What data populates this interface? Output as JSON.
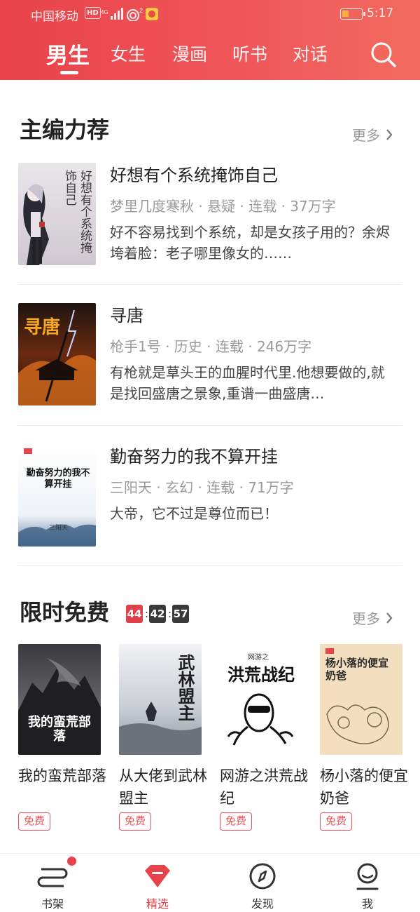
{
  "status_bar": {
    "carrier": "中国移动",
    "hd": "HD",
    "network": "4G",
    "wifi_badge": "2",
    "time": "5:17"
  },
  "header": {
    "tabs": [
      {
        "label": "男生",
        "active": true
      },
      {
        "label": "女生"
      },
      {
        "label": "漫画"
      },
      {
        "label": "听书"
      },
      {
        "label": "对话"
      }
    ],
    "search_icon": "search-icon"
  },
  "editor_picks": {
    "title": "主编力荐",
    "more_label": "更多",
    "books": [
      {
        "title": "好想有个系统掩饰自己",
        "meta": "梦里几度寒秋 · 悬疑 · 连载 · 37万字",
        "desc": "好不容易找到个系统，却是女孩子用的？余烬垮着脸：老子哪里像女的……",
        "cover_text": "好想有个系统掩饰自己"
      },
      {
        "title": "寻唐",
        "meta": "枪手1号 · 历史 · 连载 · 246万字",
        "desc": "有枪就是草头王的血腥时代里.他想要做的,就是找回盛唐之景象,重谱一曲盛唐…",
        "cover_text": "寻唐"
      },
      {
        "title": "勤奋努力的我不算开挂",
        "meta": "三阳天 · 玄幻 · 连载 · 71万字",
        "desc": "大帝，它不过是尊位而已！",
        "cover_text": "勤奋努力的我不算开挂",
        "cover_author": "三阳天"
      }
    ]
  },
  "limited_free": {
    "title": "限时免费",
    "timer": {
      "h": "44",
      "m": "42",
      "s": "57"
    },
    "more_label": "更多",
    "books": [
      {
        "title": "我的蛮荒部落",
        "tag": "免费",
        "cover_text": "我的蛮荒部落"
      },
      {
        "title": "从大佬到武林盟主",
        "tag": "免费",
        "cover_text": "武林盟主"
      },
      {
        "title": "网游之洪荒战纪",
        "tag": "免费",
        "cover_text": "洪荒战纪",
        "cover_top": "网游之"
      },
      {
        "title": "杨小落的便宜奶爸",
        "tag": "免费",
        "cover_text": "杨小落的便宜奶爸"
      }
    ]
  },
  "bottom_nav": [
    {
      "label": "书架",
      "icon": "bookshelf-icon",
      "badge": true
    },
    {
      "label": "精选",
      "icon": "featured-icon",
      "active": true
    },
    {
      "label": "发现",
      "icon": "compass-icon"
    },
    {
      "label": "我",
      "icon": "profile-icon"
    }
  ],
  "colors": {
    "brand": "#e8424a",
    "timer_first": "#e0404a",
    "timer_rest": "#3a3a3a"
  }
}
